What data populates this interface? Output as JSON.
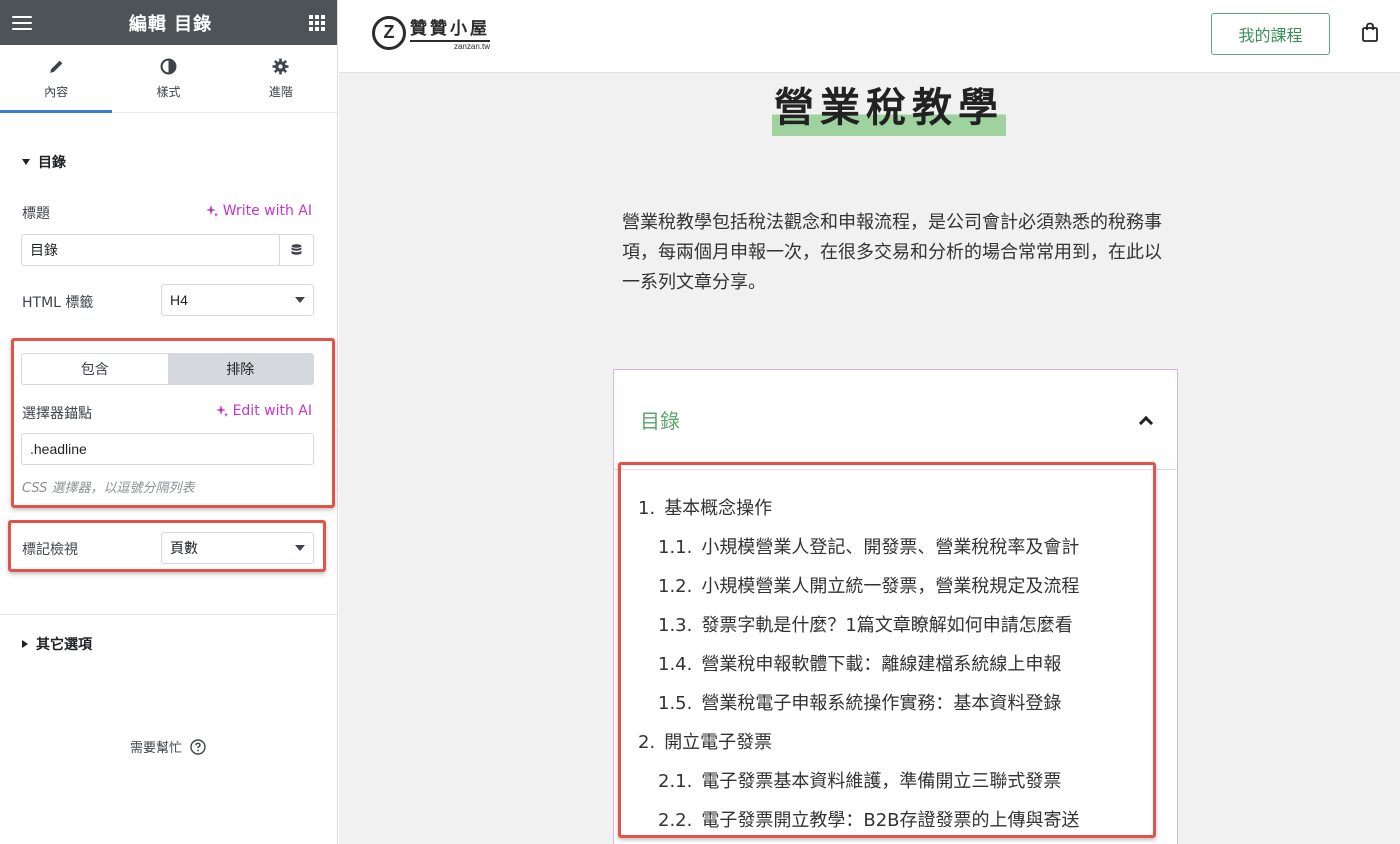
{
  "editor": {
    "title": "編輯 目錄",
    "tabs": [
      {
        "label": "內容",
        "icon": "pencil-icon",
        "active": true
      },
      {
        "label": "樣式",
        "icon": "contrast-icon",
        "active": false
      },
      {
        "label": "進階",
        "icon": "gear-icon",
        "active": false
      }
    ],
    "section_toc": "目錄",
    "title_label": "標題",
    "write_ai": "Write with AI",
    "title_value": "目錄",
    "html_tag_label": "HTML 標籤",
    "html_tag_value": "H4",
    "include_label": "包含",
    "exclude_label": "排除",
    "anchor_label": "選擇器錨點",
    "edit_ai": "Edit with AI",
    "anchor_value": ".headline",
    "anchor_hint": "CSS 選擇器，以逗號分隔列表",
    "marker_label": "標記檢視",
    "marker_value": "頁數",
    "section_other": "其它選項",
    "help": "需要幫忙"
  },
  "site": {
    "logo_main": "贊贊小屋",
    "logo_sub": "zanzan.tw",
    "course_button": "我的課程",
    "page_title": "營業稅教學",
    "intro": "營業稅教學包括稅法觀念和申報流程，是公司會計必須熟悉的稅務事項，每兩個月申報一次，在很多交易和分析的場合常常用到，在此以一系列文章分享。",
    "toc": {
      "title": "目錄",
      "items": [
        {
          "num": "1.",
          "text": "基本概念操作"
        },
        {
          "num": "1.1.",
          "text": "小規模營業人登記、開發票、營業稅稅率及會計"
        },
        {
          "num": "1.2.",
          "text": "小規模營業人開立統一發票，營業稅規定及流程"
        },
        {
          "num": "1.3.",
          "text": "發票字軌是什麼？1篇文章瞭解如何申請怎麼看"
        },
        {
          "num": "1.4.",
          "text": "營業稅申報軟體下載：離線建檔系統線上申報"
        },
        {
          "num": "1.5.",
          "text": "營業稅電子申報系統操作實務：基本資料登錄"
        },
        {
          "num": "2.",
          "text": "開立電子發票"
        },
        {
          "num": "2.1.",
          "text": "電子發票基本資料維護，準備開立三聯式發票"
        },
        {
          "num": "2.2.",
          "text": "電子發票開立教學：B2B存證發票的上傳與寄送"
        }
      ]
    }
  },
  "colors": {
    "header_bg": "#4e5358",
    "tab_active": "#3d7bd8",
    "ai_purple": "#c336c9",
    "highlight_red": "#e0544a",
    "toc_green": "#5ea56f"
  }
}
